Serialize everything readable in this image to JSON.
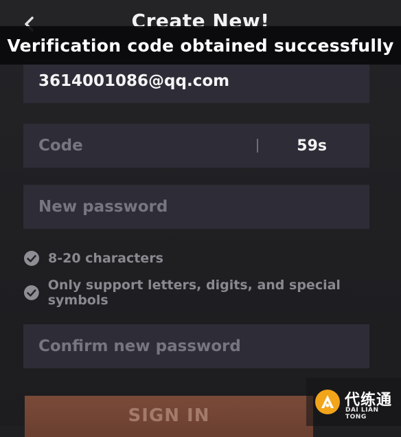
{
  "header": {
    "title": "Create New!"
  },
  "toast": {
    "message": "Verification code obtained successfully"
  },
  "form": {
    "email_value": "3614001086@qq.com",
    "code_placeholder": "Code",
    "code_timer": "59s",
    "new_password_placeholder": "New password",
    "confirm_password_placeholder": "Confirm new password"
  },
  "rules": [
    {
      "text": "8-20 characters"
    },
    {
      "text": "Only support letters, digits, and special symbols"
    }
  ],
  "buttons": {
    "sign_in_label": "SIGN IN"
  },
  "watermark": {
    "cn_text": "代练通",
    "en_text": "DAI LIAN TONG"
  },
  "colors": {
    "background": "#202023",
    "field_background": "#2e2c37",
    "sign_in_button": "#6e4333",
    "watermark_logo": "#f2a51a"
  },
  "icons": {
    "back": "chevron-left-icon",
    "rule_check": "check-circle-icon",
    "watermark_logo": "daliantong-logo-icon"
  }
}
